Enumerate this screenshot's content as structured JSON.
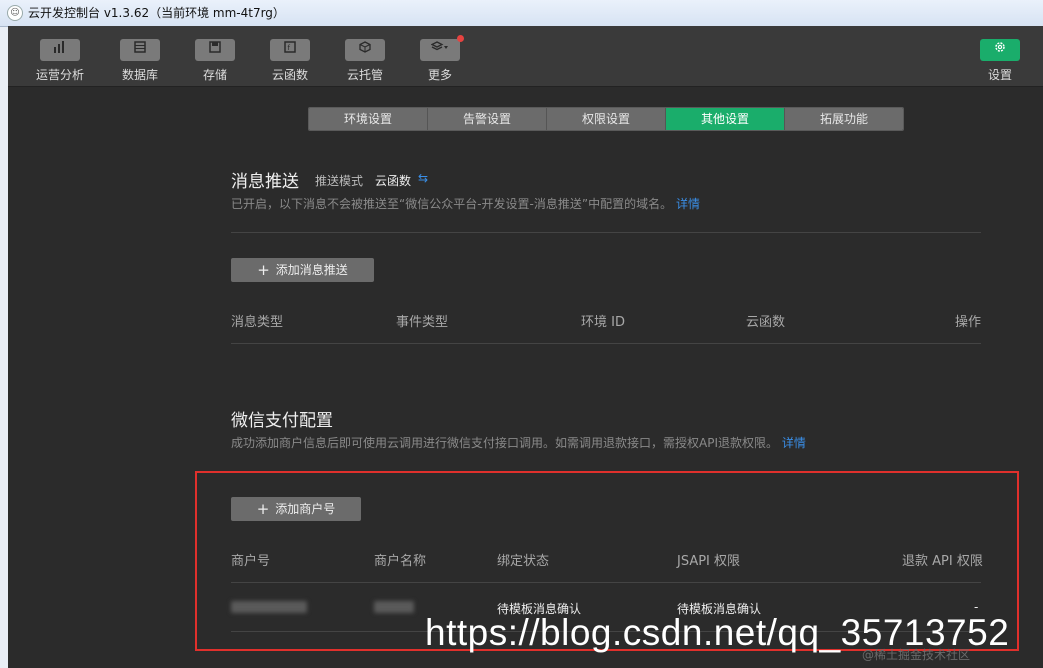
{
  "window": {
    "title": "云开发控制台 v1.3.62（当前环境 mm-4t7rg）"
  },
  "toolbar": {
    "items": [
      {
        "label": "运营分析",
        "icon": "bar-chart-icon"
      },
      {
        "label": "数据库",
        "icon": "database-icon"
      },
      {
        "label": "存储",
        "icon": "save-icon"
      },
      {
        "label": "云函数",
        "icon": "function-icon"
      },
      {
        "label": "云托管",
        "icon": "cube-icon"
      },
      {
        "label": "更多",
        "icon": "layers-icon"
      }
    ],
    "settings_label": "设置",
    "settings_icon": "gear-icon",
    "accent": "#1aad6b"
  },
  "tabs": [
    "环境设置",
    "告警设置",
    "权限设置",
    "其他设置",
    "拓展功能"
  ],
  "active_tab": "其他设置",
  "push": {
    "title": "消息推送",
    "mode_label": "推送模式",
    "mode_value": "云函数",
    "desc": "已开启，以下消息不会被推送至“微信公众平台-开发设置-消息推送”中配置的域名。",
    "link": "详情",
    "add_button": "添加消息推送",
    "columns": [
      "消息类型",
      "事件类型",
      "环境 ID",
      "云函数",
      "操作"
    ]
  },
  "pay": {
    "title": "微信支付配置",
    "desc": "成功添加商户信息后即可使用云调用进行微信支付接口调用。如需调用退款接口，需授权API退款权限。",
    "link": "详情",
    "add_button": "添加商户号",
    "columns": [
      "商户号",
      "商户名称",
      "绑定状态",
      "JSAPI 权限",
      "退款 API 权限"
    ],
    "rows": [
      {
        "bind_status": "待模板消息确认",
        "jsapi": "待模板消息确认",
        "refund": "-"
      }
    ]
  },
  "watermark": "https://blog.csdn.net/qq_35713752",
  "watermark_small": "@稀土掘金技术社区"
}
